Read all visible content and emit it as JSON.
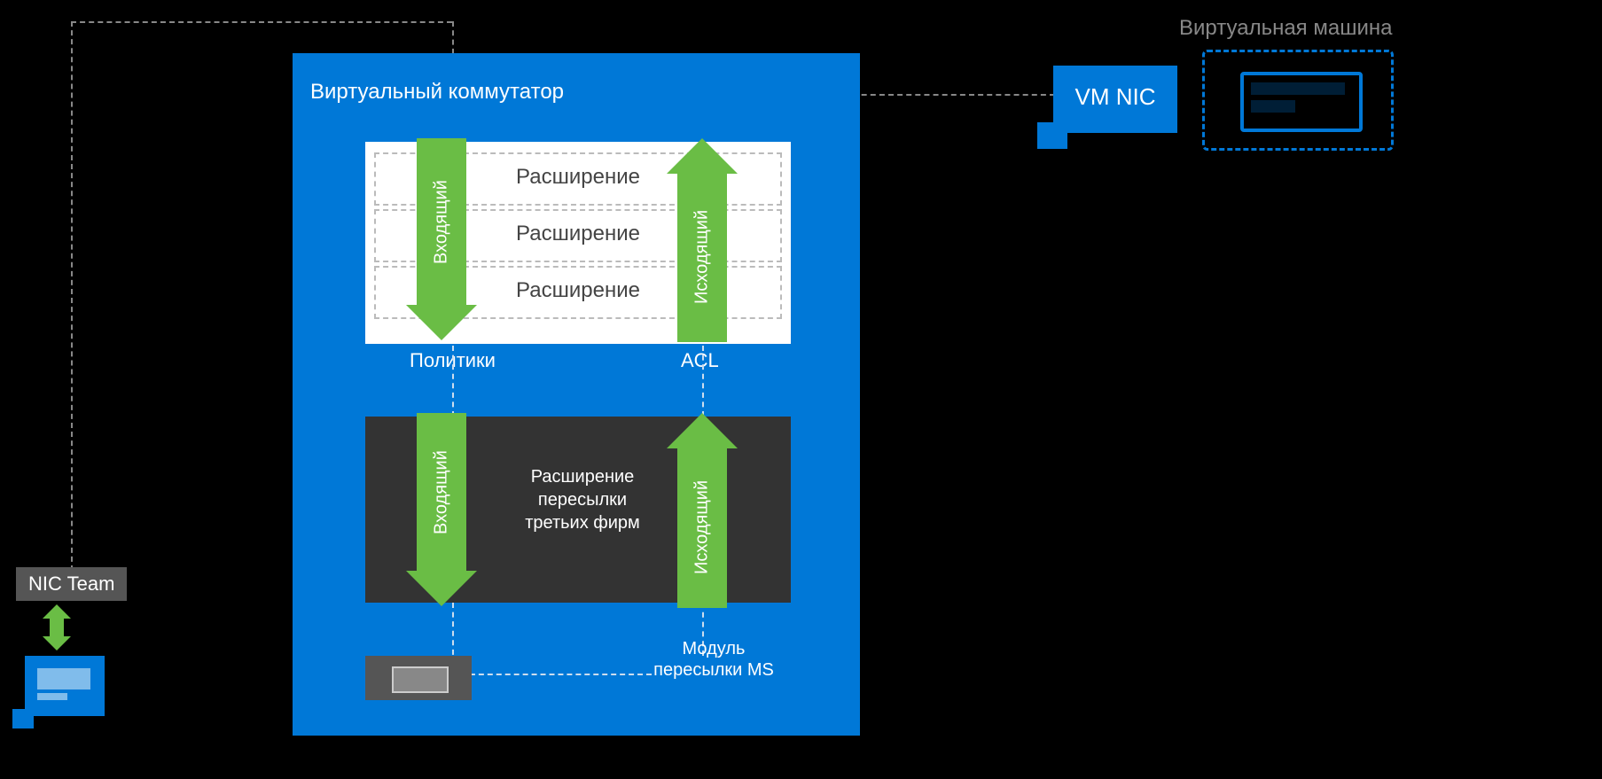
{
  "title_vm": "Виртуальная машина",
  "vswitch": {
    "title": "Виртуальный коммутатор",
    "extensions": {
      "row1": "Расширение",
      "row2": "Расширение",
      "row3": "Расширение",
      "label_policies": "Политики",
      "label_acl": "ACL"
    },
    "forwarding_third_party": "Расширение пересылки третьих фирм",
    "ms_forward_label": "Модуль пересылки MS",
    "arrow_inbound": "Входящий",
    "arrow_outbound": "Исходящий"
  },
  "vm_nic_label": "VM NIC",
  "nic_team_label": "NIC Team"
}
